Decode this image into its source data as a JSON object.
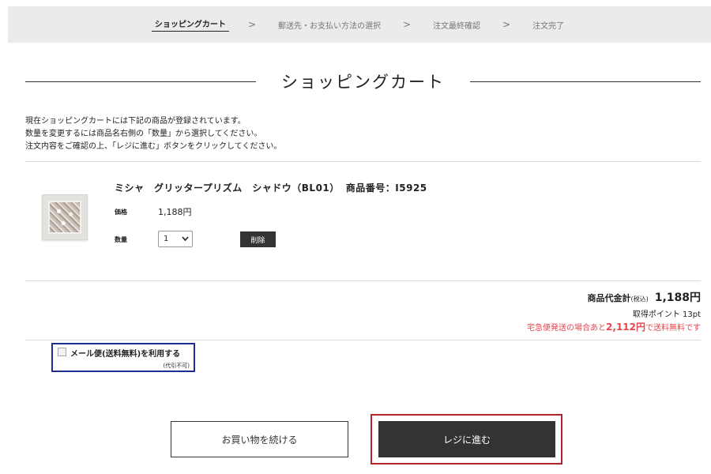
{
  "steps": {
    "items": [
      "ショッピングカート",
      "郵送先・お支払い方法の選択",
      "注文最終確認",
      "注文完了"
    ],
    "separator": ">"
  },
  "page_title": "ショッピングカート",
  "intro": [
    "現在ショッピングカートには下記の商品が登録されています。",
    "数量を変更するには商品名右側の「数量」から選択してください。",
    "注文内容をご確認の上、「レジに進む」ボタンをクリックしてください。"
  ],
  "product": {
    "name": "ミシャ　グリッタープリズム　シャドウ（BL01）",
    "code_label": "商品番号：I5925",
    "price_label": "価格",
    "price": "1,188円",
    "qty_label": "数量",
    "qty": "1",
    "delete_label": "削除"
  },
  "summary": {
    "total_label": "商品代金計",
    "tax_note": "(税込)",
    "total": "1,188円",
    "points_label": "取得ポイント 13pt",
    "free_pre": "宅急便発送の場合あと",
    "free_amount": "2,112円",
    "free_post": "で送料無料です"
  },
  "mail_option": {
    "label": "メール便(送料無料)を利用する",
    "note": "(代引不可)",
    "checked": false
  },
  "buttons": {
    "continue": "お買い物を続ける",
    "checkout": "レジに進む"
  },
  "colors": {
    "highlight_blue": "#1f2f8f",
    "highlight_red": "#b3262c",
    "alert_red": "#e8454e",
    "button_dark": "#333333"
  }
}
